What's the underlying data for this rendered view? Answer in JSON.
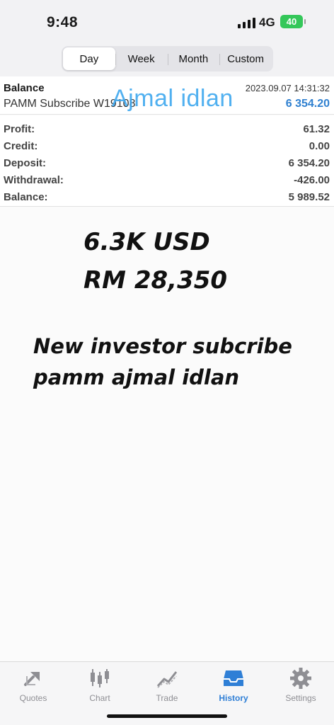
{
  "status_bar": {
    "time": "9:48",
    "network": "4G",
    "battery": "40"
  },
  "period_tabs": [
    {
      "label": "Day",
      "active": true
    },
    {
      "label": "Week",
      "active": false
    },
    {
      "label": "Month",
      "active": false
    },
    {
      "label": "Custom",
      "active": false
    }
  ],
  "deal": {
    "type": "Balance",
    "comment": "PAMM Subscribe W19108",
    "date": "2023.09.07 14:31:32",
    "amount": "6 354.20"
  },
  "watermark": "Ajmal idlan",
  "summary": [
    {
      "label": "Profit:",
      "value": "61.32"
    },
    {
      "label": "Credit:",
      "value": "0.00"
    },
    {
      "label": "Deposit:",
      "value": "6 354.20"
    },
    {
      "label": "Withdrawal:",
      "value": "-426.00"
    },
    {
      "label": "Balance:",
      "value": "5 989.52"
    }
  ],
  "overlay": {
    "usd": "6.3K USD",
    "rm": "RM 28,350",
    "note_line1": "New investor subcribe",
    "note_line2": "pamm ajmal idlan"
  },
  "tab_bar": [
    {
      "label": "Quotes",
      "icon": "quotes-icon",
      "active": false
    },
    {
      "label": "Chart",
      "icon": "chart-icon",
      "active": false
    },
    {
      "label": "Trade",
      "icon": "trade-icon",
      "active": false
    },
    {
      "label": "History",
      "icon": "history-icon",
      "active": true
    },
    {
      "label": "Settings",
      "icon": "settings-icon",
      "active": false
    }
  ],
  "colors": {
    "accent": "#2f7fd6",
    "deal_amount": "#2f80d0",
    "watermark": "#3ea8ef",
    "battery": "#34c759"
  }
}
